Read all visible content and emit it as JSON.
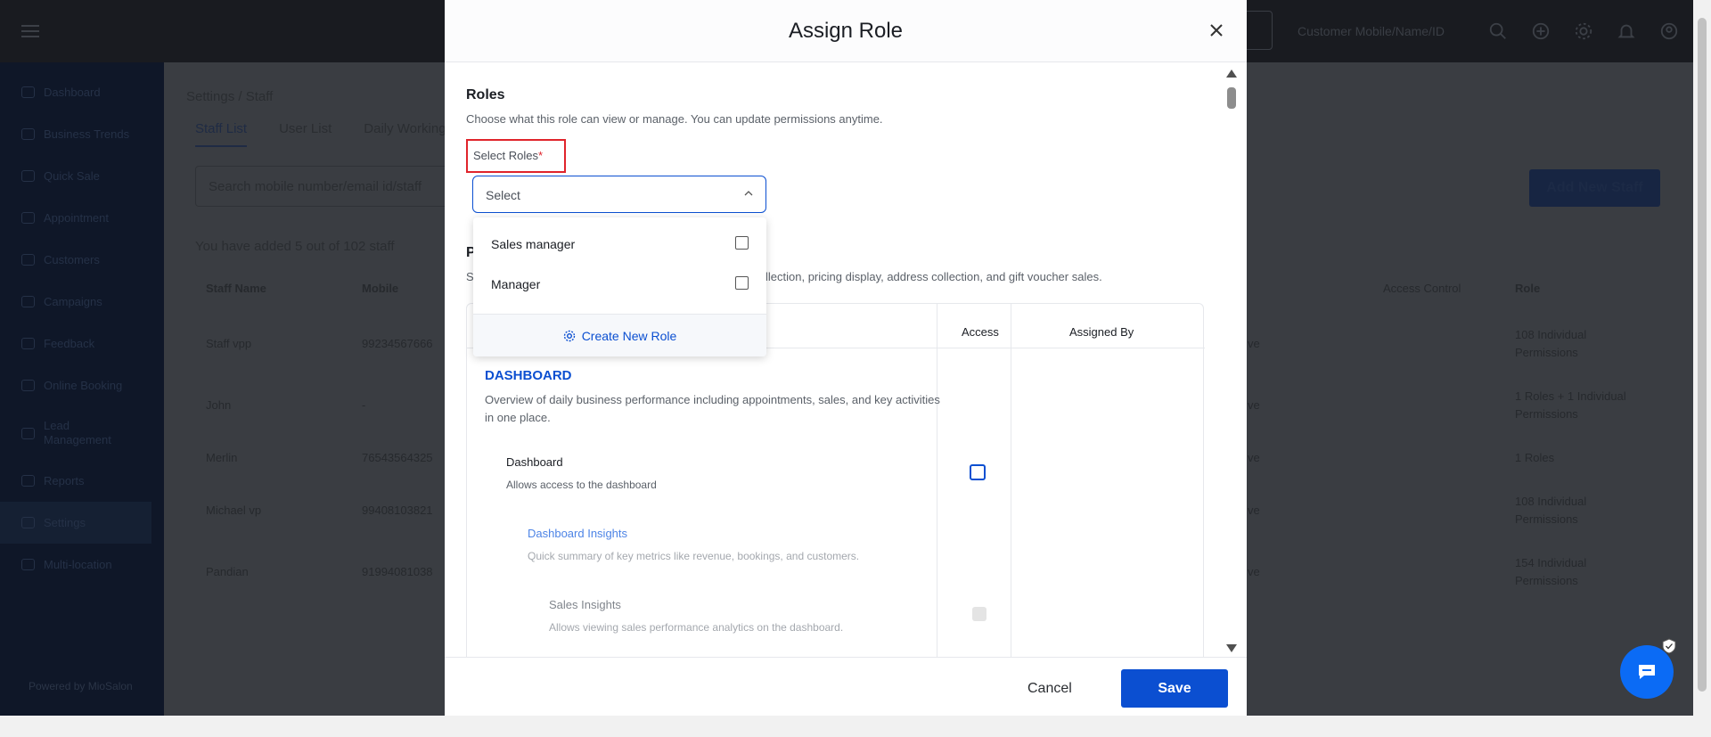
{
  "topbar": {
    "search_placeholder": "Customer Mobile/Name/ID",
    "icons": [
      "search-icon",
      "add-icon",
      "settings-gear-icon",
      "bell-icon",
      "user-icon"
    ]
  },
  "sidebar": {
    "items": [
      {
        "label": "Dashboard",
        "icon": "dashboard-icon"
      },
      {
        "label": "Business Trends",
        "icon": "bar-chart-icon"
      },
      {
        "label": "Quick Sale",
        "icon": "quick-sale-icon"
      },
      {
        "label": "Appointment",
        "icon": "calendar-icon"
      },
      {
        "label": "Customers",
        "icon": "customers-icon"
      },
      {
        "label": "Campaigns",
        "icon": "megaphone-icon"
      },
      {
        "label": "Feedback",
        "icon": "star-icon"
      },
      {
        "label": "Online Booking",
        "icon": "calendar-icon"
      },
      {
        "label": "Lead Management",
        "icon": "lead-icon"
      },
      {
        "label": "Reports",
        "icon": "reports-icon"
      },
      {
        "label": "Settings",
        "icon": "settings-icon"
      },
      {
        "label": "Multi-location",
        "icon": "location-icon"
      }
    ],
    "powered": "Powered by MioSalon"
  },
  "background": {
    "breadcrumb": "Settings  /  Staff",
    "tabs": [
      "Staff List",
      "User List",
      "Daily Working"
    ],
    "search_placeholder": "Search mobile number/email id/staff",
    "add_button": "Add New Staff",
    "added_text": "You have added 5 out of 102 staff",
    "columns": [
      "Staff Name",
      "Mobile",
      "Access Control",
      "Role"
    ],
    "rows": [
      {
        "name": "Staff vpp",
        "mobile": "99234567666",
        "status": "ve",
        "role": "108 Individual Permissions"
      },
      {
        "name": "John",
        "mobile": "-",
        "status": "ve",
        "role": "1 Roles + 1 Individual Permissions"
      },
      {
        "name": "Merlin",
        "mobile": "76543564325",
        "status": "ve",
        "role": "1 Roles"
      },
      {
        "name": "Michael vp",
        "mobile": "99408103821",
        "status": "ve",
        "role": "108 Individual Permissions"
      },
      {
        "name": "Pandian",
        "mobile": "91994081038",
        "status": "ve",
        "role": "154 Individual Permissions"
      }
    ]
  },
  "modal": {
    "title": "Assign Role",
    "roles_heading": "Roles",
    "roles_sub": "Choose what this role can view or manage. You can update permissions anytime.",
    "select_label": "Select Roles",
    "required_mark": "*",
    "select_placeholder": "Select",
    "dropdown_options": [
      {
        "label": "Sales manager",
        "checked": false
      },
      {
        "label": "Manager",
        "checked": false
      }
    ],
    "create_role": "Create New Role",
    "perm_heading_initial": "P",
    "perm_sub_initial": "S",
    "perm_sub_tail": "llection, pricing display, address collection, and gift voucher sales.",
    "table_headers": {
      "access": "Access",
      "assigned_by": "Assigned By"
    },
    "dashboard_heading": "DASHBOARD",
    "dashboard_sub": "Overview of daily business performance including appointments, sales, and key activities in one place.",
    "item_title": "Dashboard",
    "item_sub": "Allows access to the dashboard",
    "insights_title": "Dashboard Insights",
    "insights_sub": "Quick summary of key metrics like revenue, bookings, and customers.",
    "sales_title": "Sales Insights",
    "sales_sub": "Allows viewing sales performance analytics on the dashboard.",
    "cancel": "Cancel",
    "save": "Save"
  },
  "colors": {
    "primary": "#0b4fd1",
    "danger": "#e0242b",
    "chat": "#0b6bf5"
  }
}
